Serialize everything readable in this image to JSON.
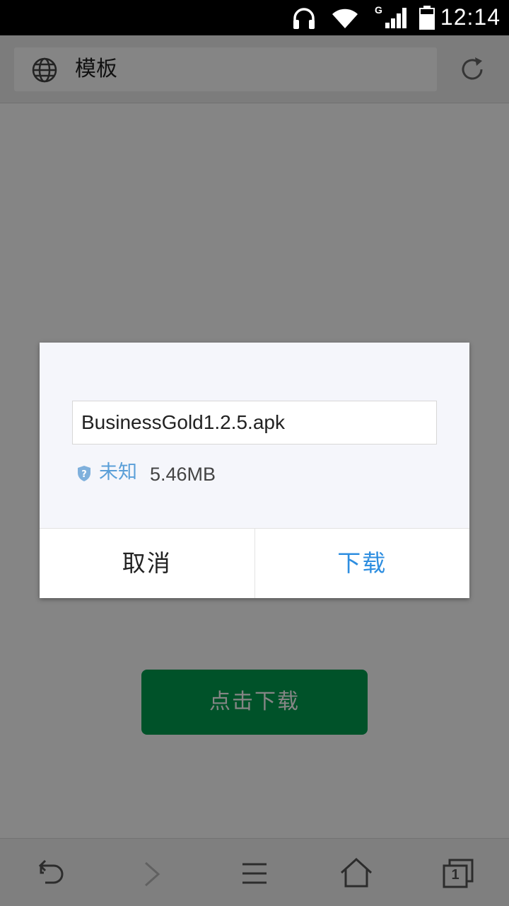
{
  "status_bar": {
    "time": "12:14",
    "network_type": "G",
    "icons": [
      "headphones-icon",
      "wifi-icon",
      "signal-icon",
      "battery-icon"
    ]
  },
  "url_bar": {
    "title": "模板",
    "icons": [
      "globe-icon",
      "refresh-icon"
    ]
  },
  "page": {
    "download_button_label": "点击下载"
  },
  "dialog": {
    "filename": "BusinessGold1.2.5.apk",
    "safety_status": "未知",
    "file_size": "5.46MB",
    "cancel_label": "取消",
    "download_label": "下载"
  },
  "toolbar": {
    "items": [
      "back-icon",
      "forward-icon",
      "menu-icon",
      "home-icon",
      "tabs-icon"
    ],
    "tab_count": "1"
  },
  "colors": {
    "accent_blue": "#2e8ee0",
    "page_button_green": "#009e4f",
    "safety_blue": "#5a9fd8"
  }
}
